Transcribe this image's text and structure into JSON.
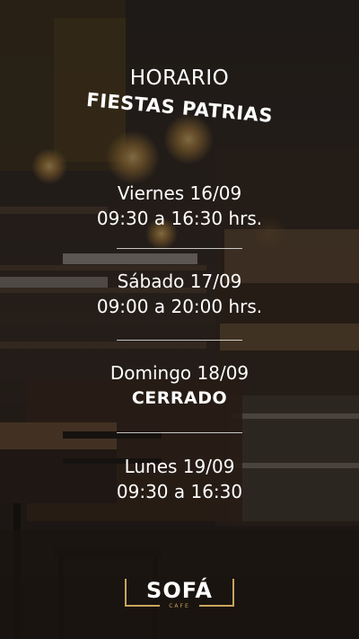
{
  "header": {
    "title_top": "HORARIO",
    "title_bottom": "FIESTAS PATRIAS"
  },
  "schedule": [
    {
      "day": "Viernes 16/09",
      "hours": "09:30 a 16:30 hrs."
    },
    {
      "day": "Sábado 17/09",
      "hours": "09:00 a 20:00 hrs."
    },
    {
      "day": "Domingo 18/09",
      "hours": "CERRADO"
    },
    {
      "day": "Lunes 19/09",
      "hours": "09:30 a 16:30"
    }
  ],
  "logo": {
    "name": "SOFÁ",
    "sub": "CAFE"
  },
  "colors": {
    "text": "#ffffff",
    "accent_gold": "#c9a45b",
    "overlay": "#14100e"
  }
}
